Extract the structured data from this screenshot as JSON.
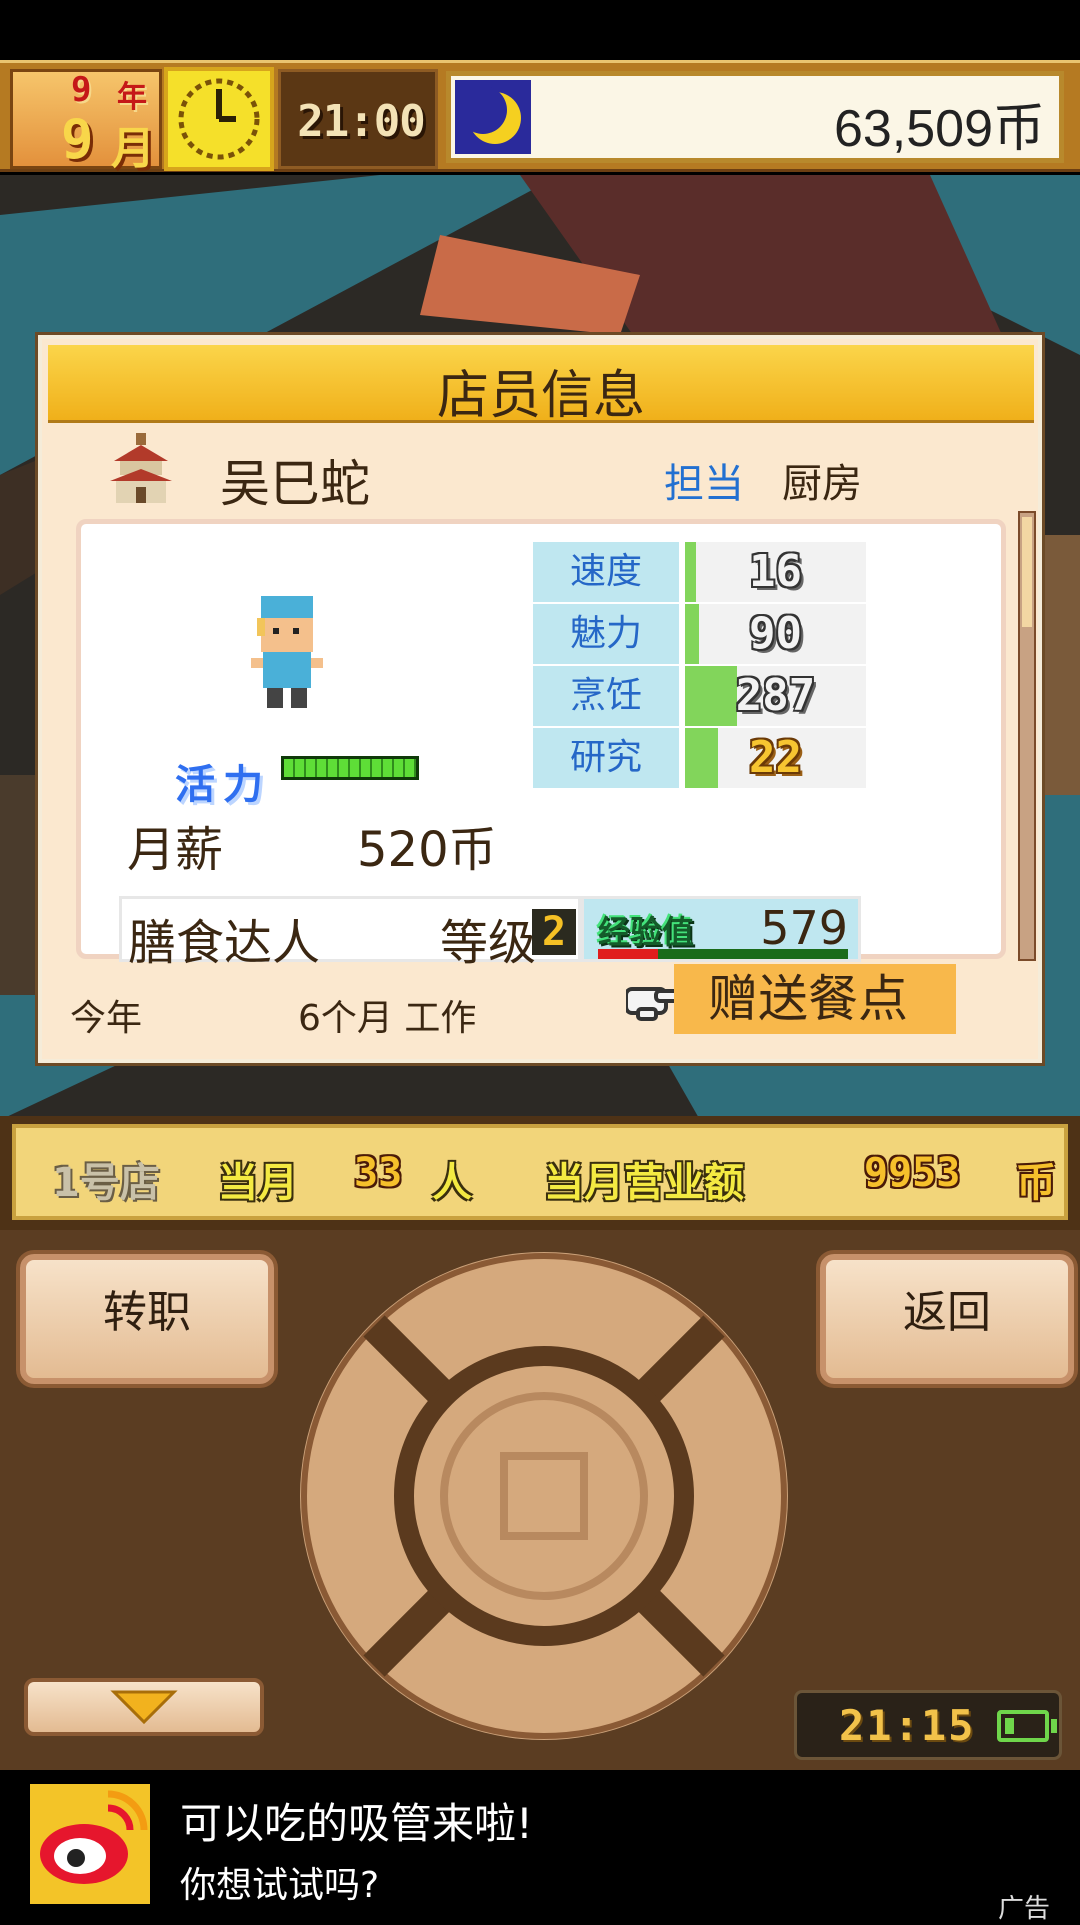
{
  "hud": {
    "year": "9",
    "year_unit": "年",
    "month": "9",
    "month_unit": "月",
    "time": "21:00",
    "money": "63,509币"
  },
  "dialog": {
    "title": "店员信息",
    "staff_name": "吴巳蛇",
    "assignment_label": "担当",
    "assignment_value": "厨房",
    "energy_label": "活力",
    "energy_level": 1.0,
    "salary_label": "月薪",
    "salary_value": "520币",
    "stats": [
      {
        "name": "速度",
        "value": "16",
        "fill": 0.06
      },
      {
        "name": "魅力",
        "value": "90",
        "fill": 0.08
      },
      {
        "name": "烹饪",
        "value": "287",
        "fill": 0.29
      },
      {
        "name": "研究",
        "value": "22",
        "fill": 0.18
      }
    ],
    "title_text": "膳食达人",
    "level_label": "等级",
    "level_value": "2",
    "exp_label": "经验值",
    "exp_value": "579",
    "exp_progress": 0.24,
    "year_label": "今年",
    "months_worked": "6个月 工作",
    "gift_button": "赠送餐点"
  },
  "store_bar": {
    "store_name": "1号店",
    "month_label": "当月",
    "visitors": "33",
    "visitors_unit": "人",
    "revenue_label": "当月营业额",
    "revenue": "9953",
    "revenue_unit": "币"
  },
  "controls": {
    "transfer_button": "转职",
    "back_button": "返回",
    "device_time": "21:15",
    "battery_level": 0.2
  },
  "ad": {
    "title": "可以吃的吸管来啦!",
    "subtitle": "你想试试吗?",
    "tag": "广告"
  },
  "colors": {
    "dialog_header": "#f7c52c",
    "stat_label_bg": "#bfe7f0",
    "stat_bar_fill": "#82d55b",
    "gift_button_bg": "#f8b84b",
    "assignment_blue": "#2270d1"
  }
}
